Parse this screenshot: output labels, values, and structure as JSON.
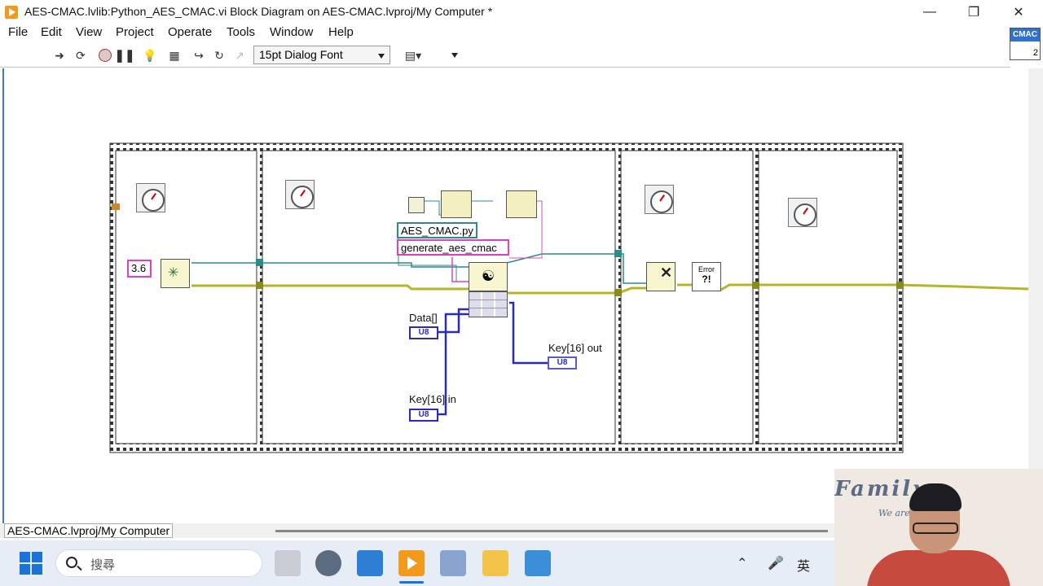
{
  "window": {
    "title": "AES-CMAC.lvlib:Python_AES_CMAC.vi Block Diagram on AES-CMAC.lvproj/My Computer *",
    "minimize_icon": "minimize-icon",
    "restore_icon": "restore-icon",
    "close_icon": "close-icon"
  },
  "menu": [
    "File",
    "Edit",
    "View",
    "Project",
    "Operate",
    "Tools",
    "Window",
    "Help"
  ],
  "toolbar": {
    "font_select_value": "15pt Dialog Font",
    "icons": [
      "run-arrow-icon",
      "run-continuously-icon",
      "abort-icon",
      "pause-icon",
      "highlight-execution-icon",
      "retain-wire-values-icon",
      "step-into-icon",
      "step-over-icon",
      "step-out-icon",
      "align-icon"
    ]
  },
  "vi_icon": {
    "label": "CMAC",
    "number": "2"
  },
  "diagram": {
    "numeric_constant": "3.6",
    "file_path_constant": "AES_CMAC.py",
    "function_name_constant": "generate_aes_cmac",
    "data_label": "Data[]",
    "key_out_label": "Key[16] out",
    "key_in_label": "Key[16] in",
    "u8_text": "U8",
    "error_text": "Error",
    "error_bang": "?!",
    "wire_colors": {
      "error": "#b5b52a",
      "session": "#2b8c8c",
      "u8": "#2a2ac0",
      "string": "#e040c0"
    }
  },
  "statusbar": {
    "context": "AES-CMAC.lvproj/My Computer"
  },
  "taskbar": {
    "search_placeholder": "搜尋",
    "tray_ime": "英",
    "apps": [
      "explorer-widgets-icon",
      "settings-icon",
      "photos-icon",
      "labview-icon",
      "notepad-plus-icon",
      "file-explorer-icon",
      "notepad-icon"
    ]
  },
  "webcam": {
    "brand": "Family",
    "tagline": "We are"
  }
}
